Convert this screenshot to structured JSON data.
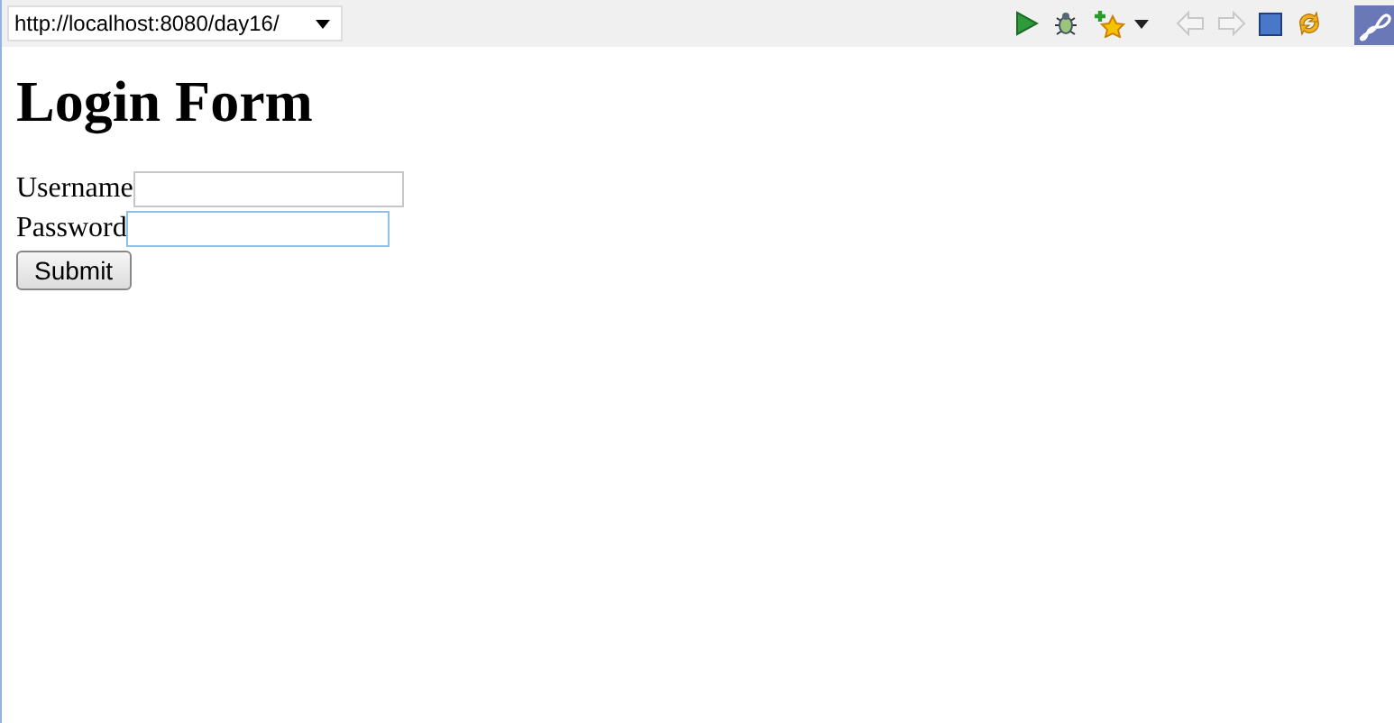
{
  "address_bar": {
    "value": "http://localhost:8080/day16/"
  },
  "toolbar": [
    {
      "kind": "run",
      "disabled": false
    },
    {
      "kind": "debug",
      "disabled": false
    },
    {
      "kind": "bookmark",
      "disabled": false
    },
    {
      "kind": "caret",
      "disabled": false
    },
    {
      "kind": "back",
      "disabled": true
    },
    {
      "kind": "forward",
      "disabled": true
    },
    {
      "kind": "stop",
      "disabled": false
    },
    {
      "kind": "refresh",
      "disabled": false
    }
  ],
  "page": {
    "heading": "Login Form",
    "fields": [
      {
        "label": "Username",
        "focused": false
      },
      {
        "label": "Password",
        "focused": true
      }
    ],
    "submit": "Submit"
  }
}
